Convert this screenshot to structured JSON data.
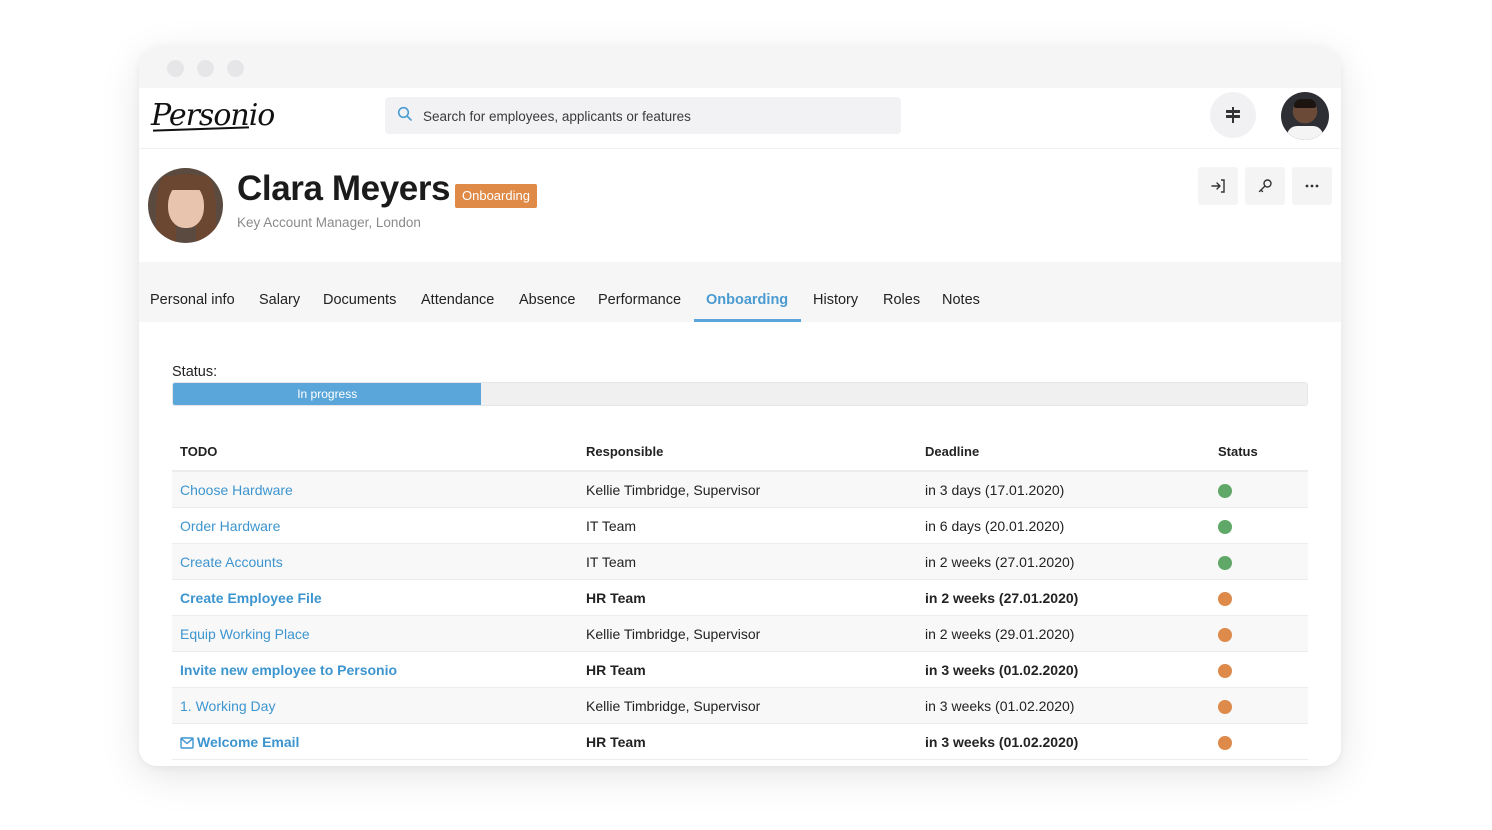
{
  "app": {
    "logo_text": "Personio",
    "search_placeholder": "Search for employees, applicants or features"
  },
  "colors": {
    "accent": "#5aa6da",
    "badge": "#e08a48",
    "status_done": "#5fa867",
    "status_pending": "#dd8a4a"
  },
  "employee": {
    "name": "Clara Meyers",
    "badge": "Onboarding",
    "subtitle": "Key Account Manager, London"
  },
  "tabs": [
    {
      "label": "Personal info"
    },
    {
      "label": "Salary"
    },
    {
      "label": "Documents"
    },
    {
      "label": "Attendance"
    },
    {
      "label": "Absence"
    },
    {
      "label": "Performance"
    },
    {
      "label": "Onboarding",
      "active": true
    },
    {
      "label": "History"
    },
    {
      "label": "Roles"
    },
    {
      "label": "Notes"
    }
  ],
  "onboarding": {
    "status_label": "Status:",
    "progress_text": "In progress",
    "progress_fraction": 0.272,
    "columns": [
      "TODO",
      "Responsible",
      "Deadline",
      "Status"
    ],
    "rows": [
      {
        "todo": "Choose Hardware",
        "responsible": "Kellie Timbridge, Supervisor",
        "deadline": "in 3 days (17.01.2020)",
        "status": "done",
        "bold": false
      },
      {
        "todo": "Order Hardware",
        "responsible": "IT Team",
        "deadline": "in 6 days (20.01.2020)",
        "status": "done",
        "bold": false
      },
      {
        "todo": "Create Accounts",
        "responsible": "IT Team",
        "deadline": "in 2 weeks (27.01.2020)",
        "status": "done",
        "bold": false
      },
      {
        "todo": "Create Employee File",
        "responsible": "HR Team",
        "deadline": "in 2 weeks (27.01.2020)",
        "status": "pending",
        "bold": true
      },
      {
        "todo": "Equip Working Place",
        "responsible": "Kellie Timbridge, Supervisor",
        "deadline": "in 2 weeks (29.01.2020)",
        "status": "pending",
        "bold": false
      },
      {
        "todo": "Invite new employee to Personio",
        "responsible": "HR Team",
        "deadline": "in 3 weeks (01.02.2020)",
        "status": "pending",
        "bold": true
      },
      {
        "todo": "1. Working Day",
        "responsible": "Kellie Timbridge, Supervisor",
        "deadline": "in 3 weeks (01.02.2020)",
        "status": "pending",
        "bold": false
      },
      {
        "todo": "Welcome Email",
        "responsible": "HR Team",
        "deadline": "in 3 weeks (01.02.2020)",
        "status": "pending",
        "bold": true,
        "icon": "mail-icon"
      }
    ]
  }
}
